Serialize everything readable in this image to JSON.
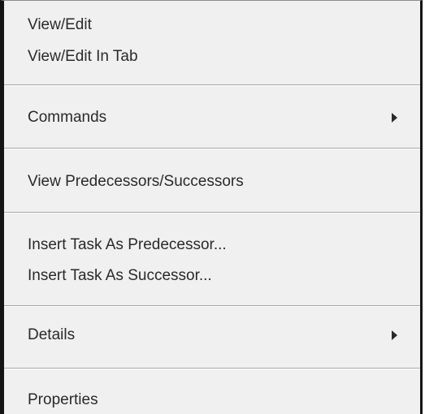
{
  "context_menu": {
    "view_edit": "View/Edit",
    "view_edit_in_tab": "View/Edit In Tab",
    "commands": "Commands",
    "view_predecessors_successors": "View Predecessors/Successors",
    "insert_task_as_predecessor": "Insert Task As Predecessor...",
    "insert_task_as_successor": "Insert Task As Successor...",
    "details": "Details",
    "properties": "Properties",
    "submenu_icon": "submenu-arrow-icon"
  }
}
